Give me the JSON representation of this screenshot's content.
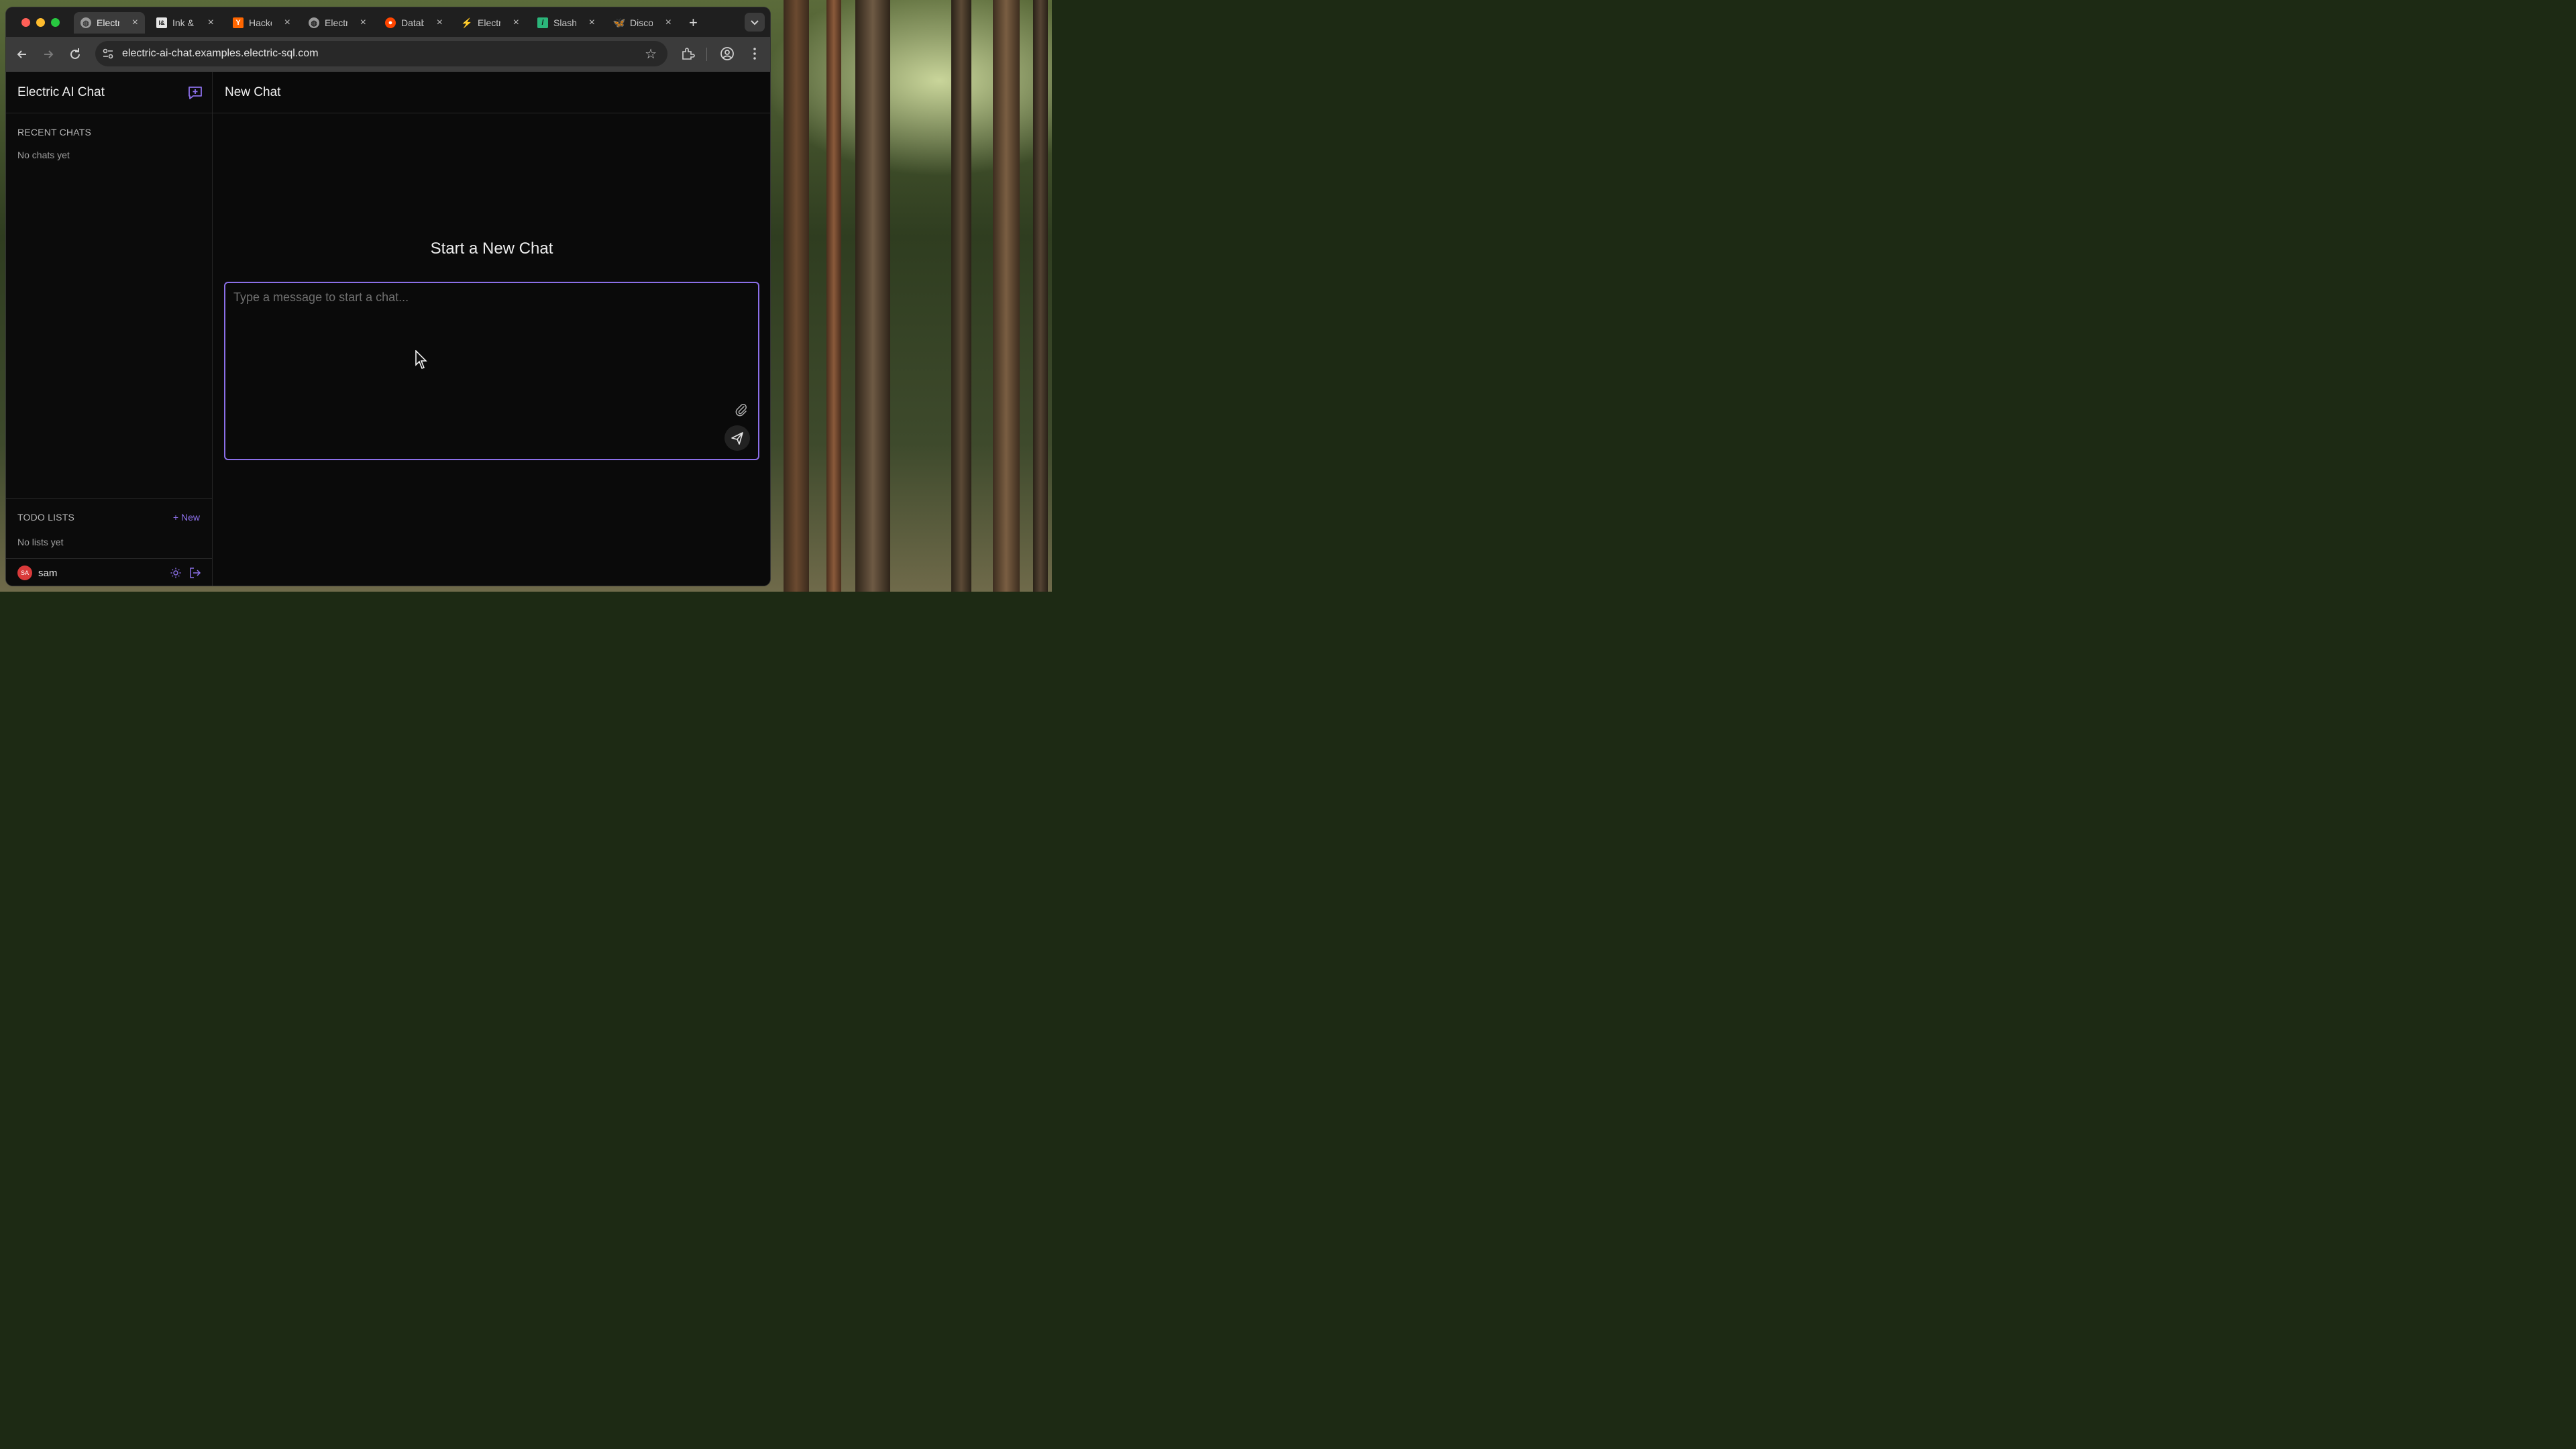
{
  "browser": {
    "tabs": [
      {
        "title": "Electr",
        "icon": "globe-icon",
        "active": true
      },
      {
        "title": "Ink &",
        "icon": "ink-and-switch-icon",
        "active": false
      },
      {
        "title": "Hacke",
        "icon": "hacker-news-icon",
        "active": false
      },
      {
        "title": "Electr",
        "icon": "globe-icon",
        "active": false
      },
      {
        "title": "Datab",
        "icon": "reddit-icon",
        "active": false
      },
      {
        "title": "Electr",
        "icon": "electric-icon",
        "active": false
      },
      {
        "title": "Slash",
        "icon": "slash-icon",
        "active": false
      },
      {
        "title": "Disco",
        "icon": "bluesky-icon",
        "active": false
      }
    ],
    "new_tab_label": "+",
    "url": "electric-ai-chat.examples.electric-sql.com",
    "accent": "#8b6fe8"
  },
  "sidebar": {
    "app_title": "Electric AI Chat",
    "recent_chats_heading": "RECENT CHATS",
    "recent_chats_empty": "No chats yet",
    "todo_heading": "TODO LISTS",
    "todo_new_label": "+ New",
    "todo_empty": "No lists yet",
    "user": {
      "initials": "SA",
      "name": "sam"
    }
  },
  "main": {
    "header_title": "New Chat",
    "heading": "Start a New Chat",
    "composer_placeholder": "Type a message to start a chat..."
  }
}
